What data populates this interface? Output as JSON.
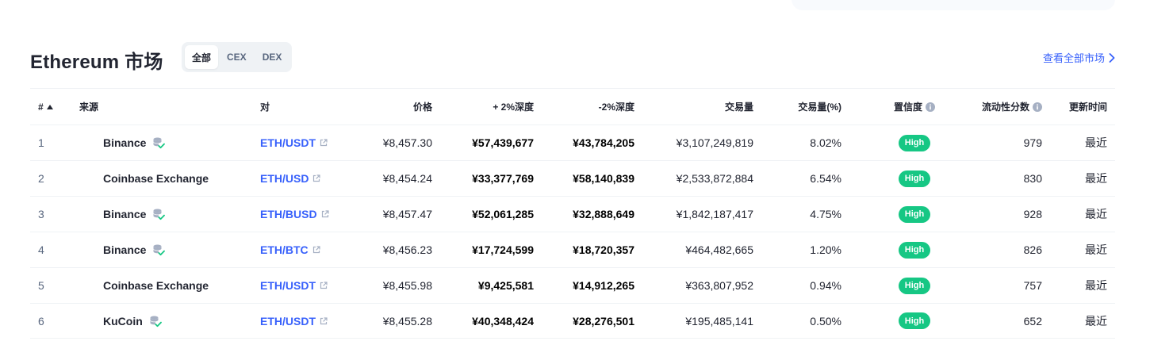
{
  "header": {
    "title": "Ethereum 市场",
    "tabs": [
      {
        "label": "全部",
        "active": true
      },
      {
        "label": "CEX",
        "active": false
      },
      {
        "label": "DEX",
        "active": false
      }
    ],
    "view_all": "查看全部市场"
  },
  "columns": {
    "num": "#",
    "source": "来源",
    "pair": "对",
    "price": "价格",
    "plus2": "+ 2%深度",
    "minus2": "-2%深度",
    "volume": "交易量",
    "volume_pct": "交易量(%)",
    "confidence": "置信度",
    "liquidity": "流动性分数",
    "updated": "更新时间"
  },
  "rows": [
    {
      "num": "1",
      "source": "Binance",
      "verified": true,
      "pair": "ETH/USDT",
      "price": "¥8,457.30",
      "plus2": "¥57,439,677",
      "minus2": "¥43,784,205",
      "volume": "¥3,107,249,819",
      "volume_pct": "8.02%",
      "confidence": "High",
      "liquidity": "979",
      "updated": "最近"
    },
    {
      "num": "2",
      "source": "Coinbase Exchange",
      "verified": false,
      "pair": "ETH/USD",
      "price": "¥8,454.24",
      "plus2": "¥33,377,769",
      "minus2": "¥58,140,839",
      "volume": "¥2,533,872,884",
      "volume_pct": "6.54%",
      "confidence": "High",
      "liquidity": "830",
      "updated": "最近"
    },
    {
      "num": "3",
      "source": "Binance",
      "verified": true,
      "pair": "ETH/BUSD",
      "price": "¥8,457.47",
      "plus2": "¥52,061,285",
      "minus2": "¥32,888,649",
      "volume": "¥1,842,187,417",
      "volume_pct": "4.75%",
      "confidence": "High",
      "liquidity": "928",
      "updated": "最近"
    },
    {
      "num": "4",
      "source": "Binance",
      "verified": true,
      "pair": "ETH/BTC",
      "price": "¥8,456.23",
      "plus2": "¥17,724,599",
      "minus2": "¥18,720,357",
      "volume": "¥464,482,665",
      "volume_pct": "1.20%",
      "confidence": "High",
      "liquidity": "826",
      "updated": "最近"
    },
    {
      "num": "5",
      "source": "Coinbase Exchange",
      "verified": false,
      "pair": "ETH/USDT",
      "price": "¥8,455.98",
      "plus2": "¥9,425,581",
      "minus2": "¥14,912,265",
      "volume": "¥363,807,952",
      "volume_pct": "0.94%",
      "confidence": "High",
      "liquidity": "757",
      "updated": "最近"
    },
    {
      "num": "6",
      "source": "KuCoin",
      "verified": true,
      "pair": "ETH/USDT",
      "price": "¥8,455.28",
      "plus2": "¥40,348,424",
      "minus2": "¥28,276,501",
      "volume": "¥195,485,141",
      "volume_pct": "0.50%",
      "confidence": "High",
      "liquidity": "652",
      "updated": "最近"
    }
  ],
  "colors": {
    "accent": "#3861fb",
    "badge_high": "#16c784",
    "text": "#222531",
    "muted": "#58667e"
  },
  "icons": {
    "sort": "caret-up-icon",
    "info": "info-icon",
    "verified": "verified-database-icon",
    "external": "external-link-icon",
    "chevron": "chevron-right-icon"
  }
}
